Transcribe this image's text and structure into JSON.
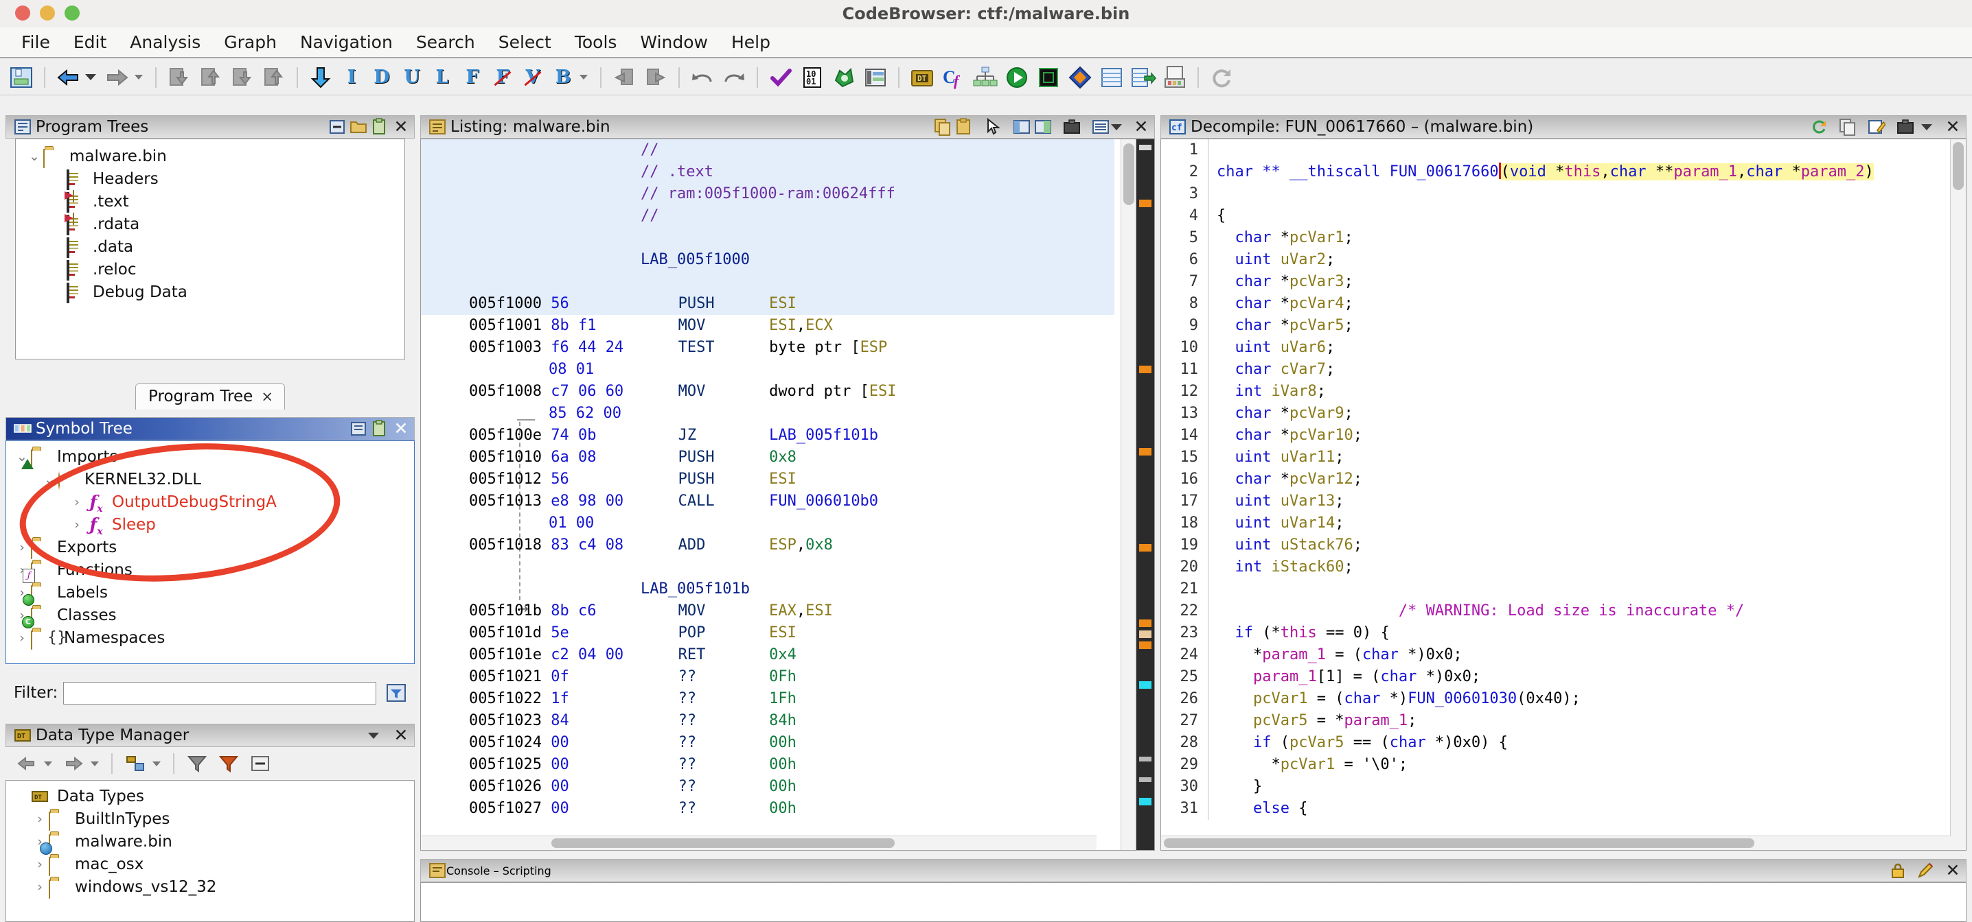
{
  "window": {
    "title": "CodeBrowser: ctf:/malware.bin",
    "traffic_lights": [
      "close",
      "minimize",
      "zoom"
    ]
  },
  "menubar": {
    "items": [
      "File",
      "Edit",
      "Analysis",
      "Graph",
      "Navigation",
      "Search",
      "Select",
      "Tools",
      "Window",
      "Help"
    ]
  },
  "toolbar": {
    "groups": [
      {
        "icons": [
          "save-icon"
        ]
      },
      {
        "icons": [
          "back-arrow-icon",
          "back-dropdown-caret-icon",
          "forward-arrow-icon",
          "forward-dropdown-caret-icon"
        ]
      },
      {
        "icons": [
          "snapshot-down-icon",
          "snapshot-up-icon",
          "copy-down-icon",
          "copy-up-icon"
        ]
      },
      {
        "icons": [
          "down-arrow-icon",
          "instruction-icon",
          "data-icon",
          "undefine-icon",
          "label-icon",
          "function-icon",
          "clear-function-icon",
          "clear-view-icon",
          "bookmark-icon",
          "bookmark-caret-icon"
        ]
      },
      {
        "icons": [
          "go-previous-icon",
          "go-next-icon"
        ]
      },
      {
        "icons": [
          "undo-icon",
          "redo-icon"
        ]
      },
      {
        "icons": [
          "check-icon",
          "binary-icon",
          "import-icon",
          "memory-map-icon",
          "datatype-icon",
          "cparser-icon",
          "function-graph-icon",
          "run-icon",
          "processor-icon",
          "diamond-icon",
          "table-icon",
          "table-export-icon",
          "archive-icon",
          "refresh-icon"
        ]
      }
    ],
    "letters": [
      "I",
      "D",
      "U",
      "L",
      "F",
      "F",
      "V",
      "B"
    ],
    "letters_struck": [
      false,
      false,
      false,
      false,
      false,
      true,
      true,
      false
    ]
  },
  "program_trees": {
    "title": "Program Trees",
    "header_icons": [
      "collapse-icon",
      "folder-open-icon",
      "paste-icon",
      "close-icon"
    ],
    "nodes": [
      {
        "label": "malware.bin",
        "icon": "folder-open-icon",
        "depth": 0,
        "twist": "⌄",
        "type": "folder"
      },
      {
        "label": "Headers",
        "icon": "fragment-icon",
        "depth": 1,
        "twist": "",
        "type": "doc"
      },
      {
        "label": ".text",
        "icon": "fragment-flag-icon",
        "depth": 1,
        "twist": "",
        "type": "docflag"
      },
      {
        "label": ".rdata",
        "icon": "fragment-flag-icon",
        "depth": 1,
        "twist": "",
        "type": "docflag"
      },
      {
        "label": ".data",
        "icon": "fragment-icon",
        "depth": 1,
        "twist": "",
        "type": "doc"
      },
      {
        "label": ".reloc",
        "icon": "fragment-icon",
        "depth": 1,
        "twist": "",
        "type": "doc"
      },
      {
        "label": "Debug Data",
        "icon": "fragment-icon",
        "depth": 1,
        "twist": "",
        "type": "doc"
      }
    ],
    "tab_label": "Program Tree",
    "tab_close": "×"
  },
  "symbol_tree": {
    "title": "Symbol Tree",
    "header_icons": [
      "clone-icon",
      "paste-icon",
      "close-icon"
    ],
    "nodes": [
      {
        "label": "Imports",
        "depth": 0,
        "twist": "⌄",
        "type": "folder-tri",
        "color": "#111111"
      },
      {
        "label": "KERNEL32.DLL",
        "depth": 1,
        "twist": "⌄",
        "type": "cube",
        "color": "#111111"
      },
      {
        "label": "OutputDebugStringA",
        "depth": 2,
        "twist": "›",
        "type": "fx",
        "color": "#e03020"
      },
      {
        "label": "Sleep",
        "depth": 2,
        "twist": "›",
        "type": "fx",
        "color": "#e03020"
      },
      {
        "label": "Exports",
        "depth": 0,
        "twist": "›",
        "type": "folder",
        "color": "#111111"
      },
      {
        "label": "Functions",
        "depth": 0,
        "twist": "›",
        "type": "folder-fx",
        "color": "#111111"
      },
      {
        "label": "Labels",
        "depth": 0,
        "twist": "›",
        "type": "folder-dot",
        "color": "#111111"
      },
      {
        "label": "Classes",
        "depth": 0,
        "twist": "›",
        "type": "folder-c",
        "color": "#111111"
      },
      {
        "label": "Namespaces",
        "depth": 0,
        "twist": "›",
        "type": "folder-braces",
        "color": "#111111"
      }
    ],
    "filter_label": "Filter:",
    "filter_value": "",
    "filter_icon": "filter-options-icon",
    "annotation": {
      "shape": "ellipse",
      "color": "#e8402a"
    }
  },
  "data_type_manager": {
    "title": "Data Type Manager",
    "header_icons": [
      "chevron-down-icon",
      "close-icon"
    ],
    "toolbar_icons": [
      "back-arrow-icon",
      "back-caret-icon",
      "forward-arrow-icon",
      "forward-caret-icon",
      "new-icon",
      "new-caret-icon",
      "filter-icon",
      "filter-red-icon",
      "collapse-icon"
    ],
    "nodes": [
      {
        "label": "Data Types",
        "depth": 0,
        "twist": "",
        "type": "root"
      },
      {
        "label": "BuiltInTypes",
        "depth": 1,
        "twist": "›",
        "type": "archive"
      },
      {
        "label": "malware.bin",
        "depth": 1,
        "twist": "›",
        "type": "archive-open"
      },
      {
        "label": "mac_osx",
        "depth": 1,
        "twist": "›",
        "type": "archive"
      },
      {
        "label": "windows_vs12_32",
        "depth": 1,
        "twist": "›",
        "type": "archive"
      }
    ]
  },
  "listing": {
    "title": "Listing:  malware.bin",
    "header_icons": [
      "copy-icon",
      "paste-icon",
      "cursor-icon",
      "layout-icon",
      "layout-alt-icon",
      "briefcase-icon",
      "menu-icon",
      "menu-caret-icon",
      "close-icon"
    ],
    "lines": [
      {
        "addr": "",
        "bytes": "",
        "mnem": "",
        "opnd": "",
        "comment": "//",
        "kind": "comment",
        "hl": true
      },
      {
        "addr": "",
        "bytes": "",
        "mnem": "",
        "opnd": "",
        "comment": "// .text",
        "kind": "comment",
        "hl": true
      },
      {
        "addr": "",
        "bytes": "",
        "mnem": "",
        "opnd": "",
        "comment": "// ram:005f1000-ram:00624fff",
        "kind": "comment",
        "hl": true
      },
      {
        "addr": "",
        "bytes": "",
        "mnem": "",
        "opnd": "",
        "comment": "//",
        "kind": "comment",
        "hl": true
      },
      {
        "addr": "",
        "bytes": "",
        "mnem": "",
        "opnd": "",
        "comment": "",
        "kind": "blank",
        "hl": true
      },
      {
        "addr": "",
        "bytes": "",
        "mnem": "",
        "opnd": "",
        "comment": "LAB_005f1000",
        "kind": "label",
        "hl": true
      },
      {
        "addr": "",
        "bytes": "",
        "mnem": "",
        "opnd": "",
        "comment": "",
        "kind": "blank",
        "hl": true
      },
      {
        "addr": "005f1000",
        "bytes": "56",
        "mnem": "PUSH",
        "opnd": "ESI",
        "opnd_kind": "reg",
        "kind": "instr",
        "hl": true
      },
      {
        "addr": "005f1001",
        "bytes": "8b f1",
        "mnem": "MOV",
        "opnd": "ESI,ECX",
        "opnd_kind": "reg",
        "kind": "instr",
        "hl": false
      },
      {
        "addr": "005f1003",
        "bytes": "f6 44 24",
        "mnem": "TEST",
        "opnd": "byte ptr [ESP",
        "opnd_kind": "mixed",
        "kind": "instr",
        "hl": false
      },
      {
        "addr": "",
        "bytes": "08 01",
        "mnem": "",
        "opnd": "",
        "kind": "cont",
        "hl": false
      },
      {
        "addr": "005f1008",
        "bytes": "c7 06 60",
        "mnem": "MOV",
        "opnd": "dword ptr [ESI",
        "opnd_kind": "mixed",
        "kind": "instr",
        "hl": false
      },
      {
        "addr": "",
        "bytes": "85 62 00",
        "mnem": "",
        "opnd": "",
        "kind": "cont",
        "hl": false
      },
      {
        "addr": "005f100e",
        "bytes": "74 0b",
        "mnem": "JZ",
        "opnd": "LAB_005f101b",
        "opnd_kind": "lab",
        "kind": "instr",
        "hl": false
      },
      {
        "addr": "005f1010",
        "bytes": "6a 08",
        "mnem": "PUSH",
        "opnd": "0x8",
        "opnd_kind": "num",
        "kind": "instr",
        "hl": false
      },
      {
        "addr": "005f1012",
        "bytes": "56",
        "mnem": "PUSH",
        "opnd": "ESI",
        "opnd_kind": "reg",
        "kind": "instr",
        "hl": false
      },
      {
        "addr": "005f1013",
        "bytes": "e8 98 00",
        "mnem": "CALL",
        "opnd": "FUN_006010b0",
        "opnd_kind": "lab",
        "kind": "instr",
        "hl": false
      },
      {
        "addr": "",
        "bytes": "01 00",
        "mnem": "",
        "opnd": "",
        "kind": "cont",
        "hl": false
      },
      {
        "addr": "005f1018",
        "bytes": "83 c4 08",
        "mnem": "ADD",
        "opnd": "ESP,0x8",
        "opnd_kind": "mixed2",
        "kind": "instr",
        "hl": false
      },
      {
        "addr": "",
        "bytes": "",
        "mnem": "",
        "opnd": "",
        "kind": "blank",
        "hl": false
      },
      {
        "addr": "",
        "bytes": "",
        "mnem": "",
        "opnd": "",
        "comment": "LAB_005f101b",
        "kind": "label",
        "hl": false
      },
      {
        "addr": "005f101b",
        "bytes": "8b c6",
        "mnem": "MOV",
        "opnd": "EAX,ESI",
        "opnd_kind": "reg",
        "kind": "instr",
        "hl": false
      },
      {
        "addr": "005f101d",
        "bytes": "5e",
        "mnem": "POP",
        "opnd": "ESI",
        "opnd_kind": "reg",
        "kind": "instr",
        "hl": false
      },
      {
        "addr": "005f101e",
        "bytes": "c2 04 00",
        "mnem": "RET",
        "opnd": "0x4",
        "opnd_kind": "num",
        "kind": "instr",
        "hl": false
      },
      {
        "addr": "005f1021",
        "bytes": "0f",
        "mnem": "??",
        "opnd": "0Fh",
        "opnd_kind": "num",
        "kind": "instr",
        "hl": false
      },
      {
        "addr": "005f1022",
        "bytes": "1f",
        "mnem": "??",
        "opnd": "1Fh",
        "opnd_kind": "num",
        "kind": "instr",
        "hl": false
      },
      {
        "addr": "005f1023",
        "bytes": "84",
        "mnem": "??",
        "opnd": "84h",
        "opnd_kind": "num",
        "kind": "instr",
        "hl": false
      },
      {
        "addr": "005f1024",
        "bytes": "00",
        "mnem": "??",
        "opnd": "00h",
        "opnd_kind": "num",
        "kind": "instr",
        "hl": false
      },
      {
        "addr": "005f1025",
        "bytes": "00",
        "mnem": "??",
        "opnd": "00h",
        "opnd_kind": "num",
        "kind": "instr",
        "hl": false
      },
      {
        "addr": "005f1026",
        "bytes": "00",
        "mnem": "??",
        "opnd": "00h",
        "opnd_kind": "num",
        "kind": "instr",
        "hl": false
      },
      {
        "addr": "005f1027",
        "bytes": "00",
        "mnem": "??",
        "opnd": "00h",
        "opnd_kind": "num",
        "kind": "instr",
        "hl": false
      }
    ]
  },
  "decompile": {
    "title": "Decompile: FUN_00617660 –  (malware.bin)",
    "header_icons": [
      "refresh-icon",
      "copy-icon",
      "edit-icon",
      "briefcase-icon",
      "menu-caret-icon",
      "close-icon"
    ],
    "lines": [
      {
        "n": "1",
        "code": ""
      },
      {
        "n": "2",
        "code": "char ** __thiscall FUN_00617660(void *this,char **param_1,char *param_2)",
        "kind": "signature"
      },
      {
        "n": "3",
        "code": ""
      },
      {
        "n": "4",
        "code": "{"
      },
      {
        "n": "5",
        "code": "  char *pcVar1;"
      },
      {
        "n": "6",
        "code": "  uint uVar2;"
      },
      {
        "n": "7",
        "code": "  char *pcVar3;"
      },
      {
        "n": "8",
        "code": "  char *pcVar4;"
      },
      {
        "n": "9",
        "code": "  char *pcVar5;"
      },
      {
        "n": "10",
        "code": "  uint uVar6;"
      },
      {
        "n": "11",
        "code": "  char cVar7;"
      },
      {
        "n": "12",
        "code": "  int iVar8;"
      },
      {
        "n": "13",
        "code": "  char *pcVar9;"
      },
      {
        "n": "14",
        "code": "  char *pcVar10;"
      },
      {
        "n": "15",
        "code": "  uint uVar11;"
      },
      {
        "n": "16",
        "code": "  char *pcVar12;"
      },
      {
        "n": "17",
        "code": "  uint uVar13;"
      },
      {
        "n": "18",
        "code": "  uint uVar14;"
      },
      {
        "n": "19",
        "code": "  uint uStack76;"
      },
      {
        "n": "20",
        "code": "  int iStack60;"
      },
      {
        "n": "21",
        "code": ""
      },
      {
        "n": "22",
        "code": "                    /* WARNING: Load size is inaccurate */",
        "kind": "warning"
      },
      {
        "n": "23",
        "code": "  if (*this == 0) {"
      },
      {
        "n": "24",
        "code": "    *param_1 = (char *)0x0;"
      },
      {
        "n": "25",
        "code": "    param_1[1] = (char *)0x0;"
      },
      {
        "n": "26",
        "code": "    pcVar1 = (char *)FUN_00601030(0x40);"
      },
      {
        "n": "27",
        "code": "    pcVar5 = *param_1;"
      },
      {
        "n": "28",
        "code": "    if (pcVar5 == (char *)0x0) {"
      },
      {
        "n": "29",
        "code": "      *pcVar1 = '\\0';"
      },
      {
        "n": "30",
        "code": "    }"
      },
      {
        "n": "31",
        "code": "    else {"
      }
    ],
    "signature_parts": {
      "ret": "char **",
      "conv": "__thiscall",
      "name": "FUN_00617660",
      "args": "(void *this,char **param_1,char *param_2)"
    }
  },
  "console": {
    "title": "Console – Scripting",
    "header_icons": [
      "lock-icon",
      "pencil-icon",
      "close-icon"
    ]
  }
}
